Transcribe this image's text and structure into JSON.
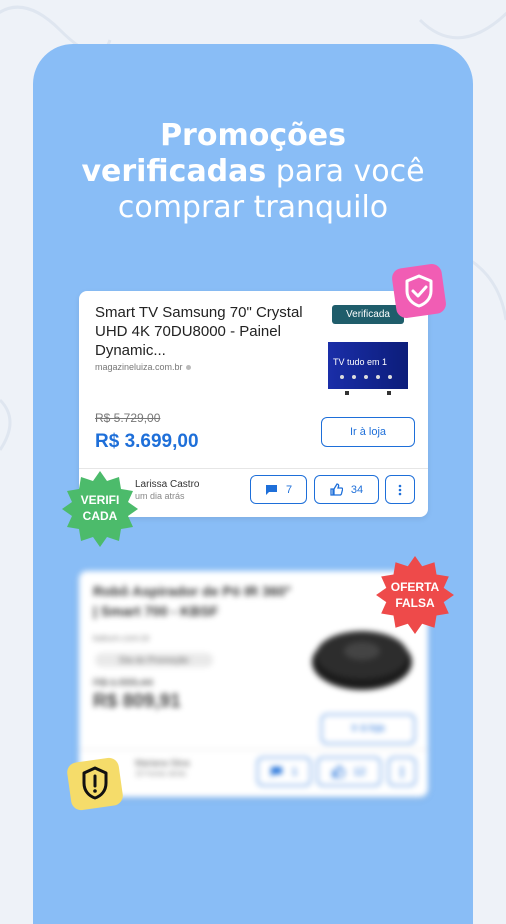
{
  "colors": {
    "panel": "#89bdf6",
    "accent_blue": "#1e6fd9",
    "verified_badge": "#1f5d6b",
    "seal_green": "#4cbb6b",
    "seal_red": "#ee4a4a",
    "shield_pink": "#f15db4",
    "warn_yellow": "#f5dc6a"
  },
  "headline": {
    "line1": "Promoções",
    "line2_bold": "verificadas",
    "line2_rest": " para você",
    "line3": "comprar tranquilo"
  },
  "card_verified": {
    "title": "Smart TV Samsung 70\" Crystal UHD 4K 70DU8000 - Painel Dynamic...",
    "store": "magazineluiza.com.br",
    "badge": "Verificada",
    "tv_screen_text": "TV tudo em 1",
    "old_price": "R$ 5.729,00",
    "new_price": "R$ 3.699,00",
    "store_button": "Ir à loja",
    "user_name": "Larissa Castro",
    "user_time": "um dia atrás",
    "comments": "7",
    "likes": "34"
  },
  "seal_verified": {
    "line1": "VERIFI",
    "line2": "CADA"
  },
  "card_fake": {
    "title": "Robô Aspirador de Pó IR 360° | Smart 700 - KBSF",
    "store": "kabum.com.br",
    "chip": "Dia do Promoção",
    "old_price": "R$ 1.555,44",
    "new_price": "R$ 809,91",
    "store_button": "Ir à loja",
    "user_name": "Mariana Silva",
    "user_time": "10 horas atrás",
    "comments": "1",
    "likes": "12"
  },
  "seal_fake": {
    "line1": "OFERTA",
    "line2": "FALSA"
  },
  "icons": [
    "shield-check-icon",
    "comment-icon",
    "thumbs-up-icon",
    "more-vertical-icon",
    "warning-shield-icon"
  ]
}
